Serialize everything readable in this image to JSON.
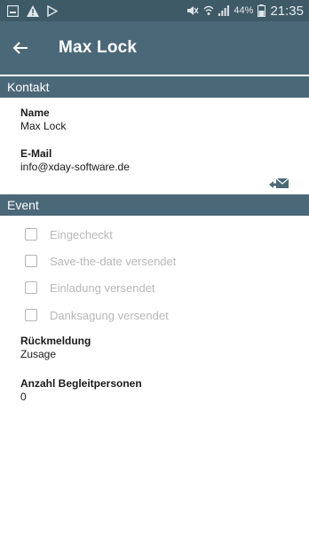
{
  "statusbar": {
    "left_icons": [
      "gallery-icon",
      "warning-icon",
      "play-icon"
    ],
    "battery": "44%",
    "time": "21:35"
  },
  "appbar": {
    "title": "Max Lock"
  },
  "kontakt": {
    "header": "Kontakt",
    "name_label": "Name",
    "name_value": "Max Lock",
    "email_label": "E-Mail",
    "email_value": "info@xday-software.de"
  },
  "event": {
    "header": "Event",
    "checkboxes": [
      {
        "label": "Eingecheckt",
        "checked": false
      },
      {
        "label": "Save-the-date versendet",
        "checked": false
      },
      {
        "label": "Einladung versendet",
        "checked": false
      },
      {
        "label": "Danksagung versendet",
        "checked": false
      }
    ],
    "rueckmeldung_label": "Rückmeldung",
    "rueckmeldung_value": "Zusage",
    "begleit_label": "Anzahl Begleitpersonen",
    "begleit_value": "0"
  },
  "colors": {
    "appbar": "#4b6878",
    "statusbar": "#3f5a67",
    "disabled_text": "#b8b8b8"
  }
}
